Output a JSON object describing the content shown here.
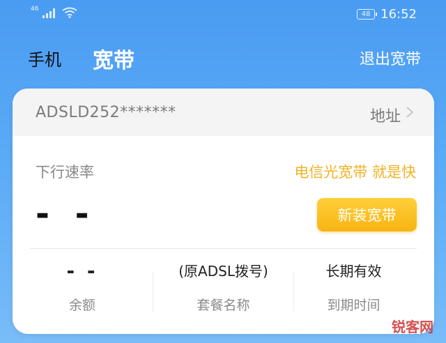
{
  "status_bar": {
    "network_label": "46",
    "battery_level": "48",
    "time": "16:52"
  },
  "nav": {
    "tab_phone": "手机",
    "tab_broadband": "宽带",
    "logout": "退出宽带"
  },
  "account": {
    "id": "ADSLD252*******",
    "address_label": "地址"
  },
  "speed": {
    "label": "下行速率",
    "value": "- -",
    "promo": "电信光宽带 就是快",
    "new_button": "新装宽带"
  },
  "stats": {
    "balance_value": "- -",
    "balance_label": "余额",
    "plan_value": "(原ADSL拨号)",
    "plan_label": "套餐名称",
    "expiry_value": "长期有效",
    "expiry_label": "到期时间"
  },
  "watermark": "锐客网",
  "colors": {
    "accent_blue": "#4a9cf2",
    "promo_gold": "#f0b224",
    "button_gold": "#f7b412"
  }
}
